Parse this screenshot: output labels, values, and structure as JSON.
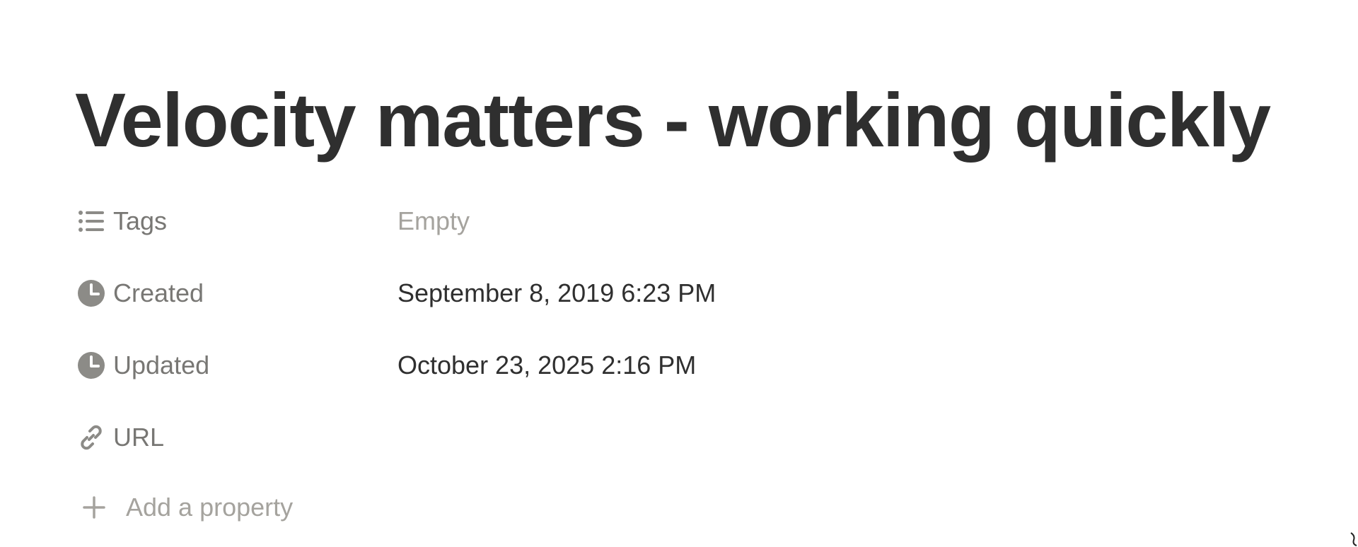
{
  "page": {
    "title": "Velocity matters - working quickly"
  },
  "properties": [
    {
      "name": "Tags",
      "icon": "list-icon",
      "value": "Empty",
      "empty": true
    },
    {
      "name": "Created",
      "icon": "clock-icon",
      "value": "September 8, 2019 6:23 PM",
      "empty": false
    },
    {
      "name": "Updated",
      "icon": "clock-icon",
      "value": "October 23, 2025 2:16 PM",
      "empty": false
    },
    {
      "name": "URL",
      "icon": "link-icon",
      "value": "",
      "empty": true
    }
  ],
  "add_property": {
    "label": "Add a property",
    "icon": "plus-icon"
  },
  "colors": {
    "title": "#2f2f2f",
    "property_label": "#787774",
    "placeholder": "#a5a39e",
    "value": "#2f2f2f",
    "icon": "#8c8b87"
  }
}
